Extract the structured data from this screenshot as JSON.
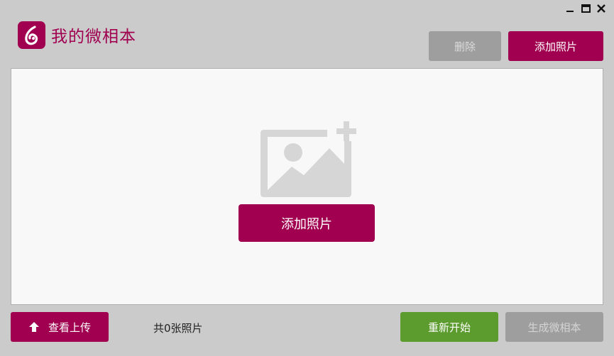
{
  "window": {
    "controls": {
      "minimize_icon": "minimize-icon",
      "maximize_icon": "maximize-icon",
      "close_icon": "close-icon"
    }
  },
  "header": {
    "logo_icon": "app-logo-icon",
    "title": "我的微相本"
  },
  "toolbar": {
    "delete_label": "删除",
    "add_photo_label": "添加照片"
  },
  "canvas": {
    "placeholder_icon": "add-image-icon",
    "add_photo_label": "添加照片"
  },
  "footer": {
    "upload_label": "查看上传",
    "upload_icon": "arrow-up-icon",
    "photo_count_text": "共0张照片",
    "restart_label": "重新开始",
    "generate_label": "生成微相本"
  },
  "colors": {
    "accent": "#a0004f",
    "green": "#5c9b2e",
    "disabled": "#9e9e9e",
    "background": "#cbcbcb",
    "canvas": "#f8f8f8"
  }
}
